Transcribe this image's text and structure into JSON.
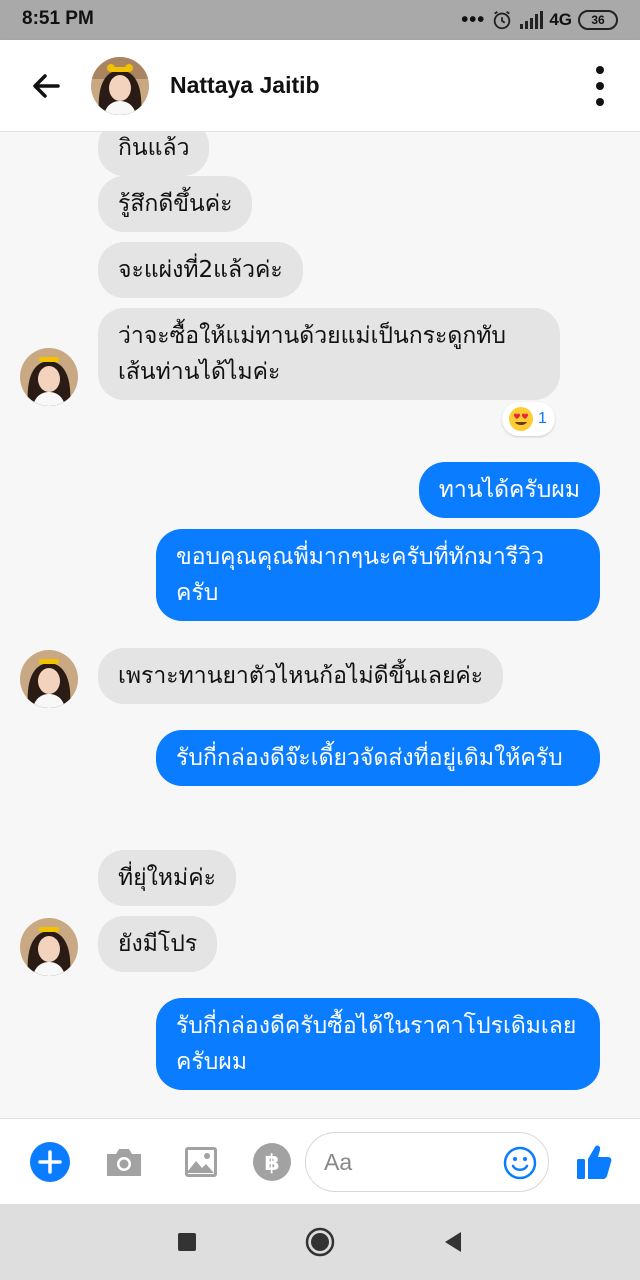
{
  "status_bar": {
    "time": "8:51 PM",
    "dots": "•••",
    "network": "4G",
    "battery": "36"
  },
  "header": {
    "contact_name": "Nattaya Jaitib"
  },
  "messages": [
    {
      "side": "in",
      "text": "กินแล้ว"
    },
    {
      "side": "in",
      "text": "รู้สึกดีขึ้นค่ะ"
    },
    {
      "side": "in",
      "text": "จะแผ่งที่2แล้วค่ะ"
    },
    {
      "side": "in",
      "text": "ว่าจะซื้อให้แม่ทานด้วยแม่เป็นกระดูกทับเส้นท่านได้ไมค่ะ"
    },
    {
      "side": "out",
      "text": "ทานได้ครับผม"
    },
    {
      "side": "out",
      "text": "ขอบคุณคุณพี่มากๆนะครับที่ทักมารีวิวครับ"
    },
    {
      "side": "in",
      "text": "เพราะทานยาตัวไหนก้อไม่ดีขึ้นเลยค่ะ"
    },
    {
      "side": "out",
      "text": "รับกี่กล่องดีจ๊ะเดี้ยวจัดส่งที่อยู่เดิมให้ครับ"
    },
    {
      "side": "in",
      "text": "ที่ยุ่ใหม่ค่ะ"
    },
    {
      "side": "in",
      "text": "ยังมีโปร"
    },
    {
      "side": "out",
      "text": "รับกี่กล่องดีครับซื้อได้ในราคาโปรเดิมเลยครับผม"
    }
  ],
  "reaction": {
    "emoji": "heart-eyes",
    "count": "1"
  },
  "composer": {
    "placeholder": "Aa"
  },
  "colors": {
    "accent": "#0a7cff",
    "incoming_bubble": "#e4e4e4"
  }
}
